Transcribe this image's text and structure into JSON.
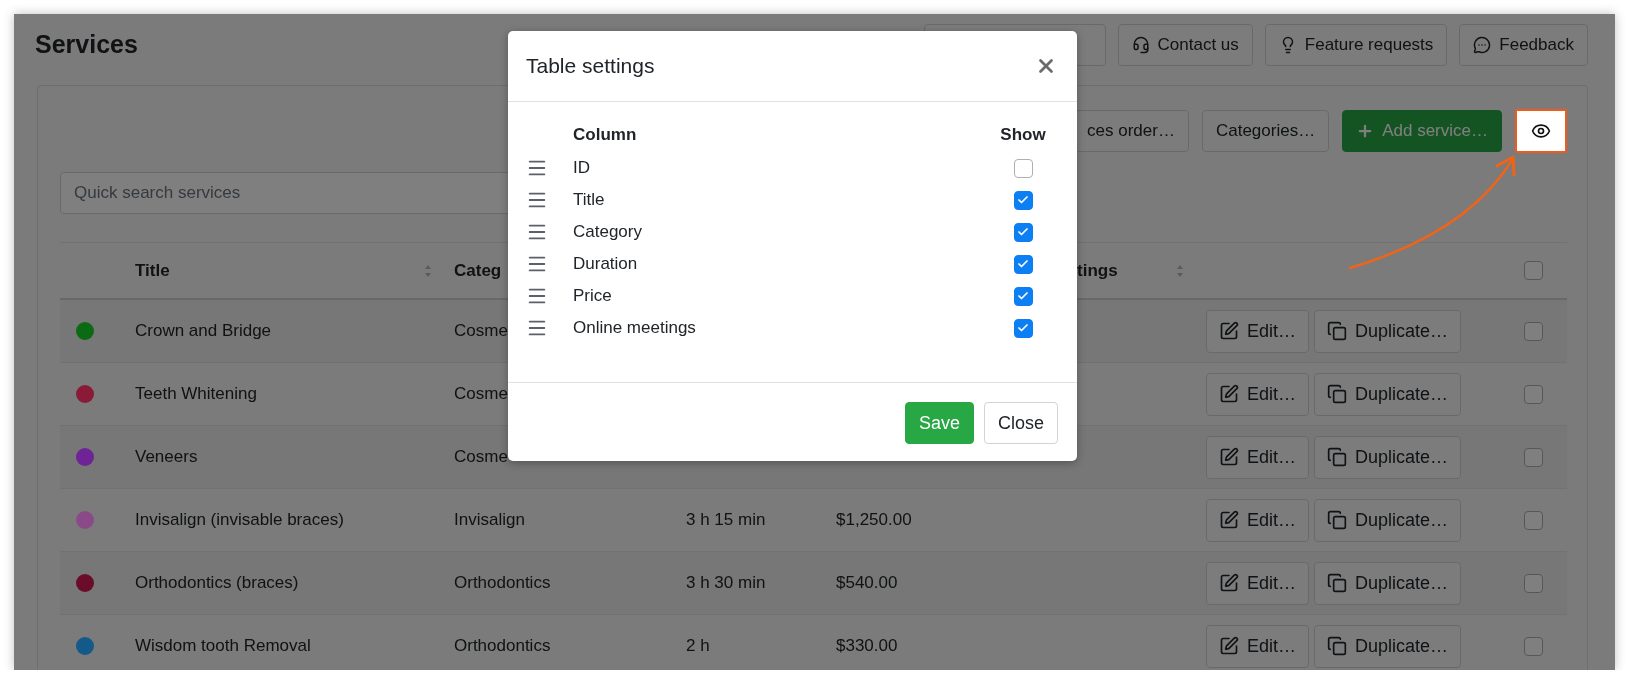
{
  "page": {
    "title": "Services"
  },
  "header_buttons": [
    {
      "kind": "covered"
    },
    {
      "kind": "contact",
      "label": "Contact us"
    },
    {
      "kind": "feature",
      "label": "Feature requests"
    },
    {
      "kind": "feedback",
      "label": "Feedback"
    }
  ],
  "toolbar": [
    {
      "kind": "plain",
      "label": "ces order…"
    },
    {
      "kind": "plain",
      "label": "Categories…"
    },
    {
      "kind": "add",
      "label": "Add service…"
    },
    {
      "kind": "view",
      "highlighted": true
    }
  ],
  "search": {
    "placeholder": "Quick search services"
  },
  "table": {
    "header": {
      "title": {
        "label": "Title",
        "sortable": true
      },
      "category": {
        "label": "Categ"
      },
      "online_meetings": {
        "label": "tings",
        "sortable": true
      },
      "checked": false
    },
    "rows": [
      {
        "color": "#0b6a14",
        "title": "Crown and Bridge",
        "category": "Cosme",
        "edit_label": "Edit…",
        "duplicate_label": "Duplicate…",
        "checked": false
      },
      {
        "color": "#8a1a38",
        "title": "Teeth Whitening",
        "category": "Cosme",
        "edit_label": "Edit…",
        "duplicate_label": "Duplicate…",
        "checked": false
      },
      {
        "color": "#6e2496",
        "title": "Veneers",
        "category": "Cosme",
        "edit_label": "Edit…",
        "duplicate_label": "Duplicate…",
        "checked": false
      },
      {
        "color": "#8a4a88",
        "title": "Invisalign (invisable braces)",
        "category": "Invisalign",
        "duration": "3 h 15 min",
        "price": "$1,250.00",
        "edit_label": "Edit…",
        "duplicate_label": "Duplicate…",
        "checked": false
      },
      {
        "color": "#6a0c2a",
        "title": "Orthodontics (braces)",
        "category": "Orthodontics",
        "duration": "3 h 30 min",
        "price": "$540.00",
        "edit_label": "Edit…",
        "duplicate_label": "Duplicate…",
        "checked": false
      },
      {
        "color": "#135a8a",
        "title": "Wisdom tooth Removal",
        "category": "Orthodontics",
        "duration": "2 h",
        "price": "$330.00",
        "edit_label": "Edit…",
        "duplicate_label": "Duplicate…",
        "checked": false
      }
    ]
  },
  "modal": {
    "title": "Table settings",
    "column_heading": "Column",
    "show_heading": "Show",
    "columns": [
      {
        "label": "ID",
        "checked": false
      },
      {
        "label": "Title",
        "checked": true
      },
      {
        "label": "Category",
        "checked": true
      },
      {
        "label": "Duration",
        "checked": true
      },
      {
        "label": "Price",
        "checked": true
      },
      {
        "label": "Online meetings",
        "checked": true
      }
    ],
    "buttons": [
      {
        "kind": "primary",
        "label": "Save"
      },
      {
        "kind": "secondary",
        "label": "Close"
      }
    ]
  }
}
